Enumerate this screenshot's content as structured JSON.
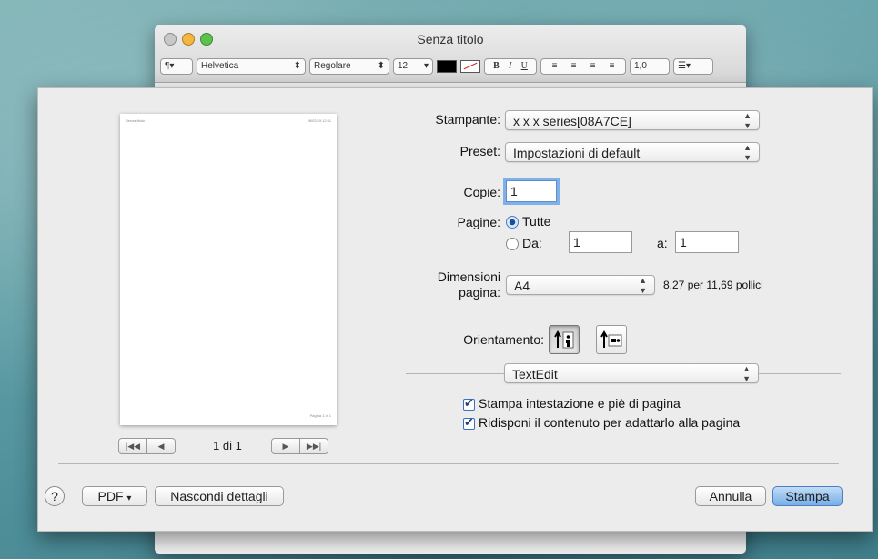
{
  "window": {
    "title": "Senza titolo",
    "toolbar": {
      "para_label": "¶▾",
      "font_family": "Helvetica",
      "font_style": "Regolare",
      "font_size": "12",
      "bold": "B",
      "italic": "I",
      "underline": "U",
      "line_spacing": "1,0",
      "list_label": "☰▾"
    }
  },
  "preview": {
    "header_left": "Senza titolo",
    "header_right": "28/02/15 12:11",
    "footer": "Pagina 1 di 1",
    "page_indicator": "1 di 1"
  },
  "form": {
    "printer_label": "Stampante:",
    "printer_value": "x x x  series[08A7CE]",
    "preset_label": "Preset:",
    "preset_value": "Impostazioni di default",
    "copies_label": "Copie:",
    "copies_value": "1",
    "pages_label": "Pagine:",
    "pages_all": "Tutte",
    "pages_from": "Da:",
    "from_value": "1",
    "to_label": "a:",
    "to_value": "1",
    "size_label_1": "Dimensioni",
    "size_label_2": "pagina:",
    "size_value": "A4",
    "size_desc": "8,27 per 11,69 pollici",
    "orientation_label": "Orientamento:",
    "app_section": "TextEdit",
    "opt_header_footer": "Stampa intestazione e piè di pagina",
    "opt_rewrap": "Ridisponi il contenuto per adattarlo alla pagina"
  },
  "footer": {
    "help": "?",
    "pdf_label": "PDF",
    "details_label": "Nascondi dettagli",
    "cancel_label": "Annulla",
    "print_label": "Stampa"
  },
  "icons": [
    "help-icon",
    "chevron-down-icon",
    "portrait-icon",
    "landscape-icon",
    "first-page-icon",
    "prev-page-icon",
    "next-page-icon",
    "last-page-icon"
  ]
}
